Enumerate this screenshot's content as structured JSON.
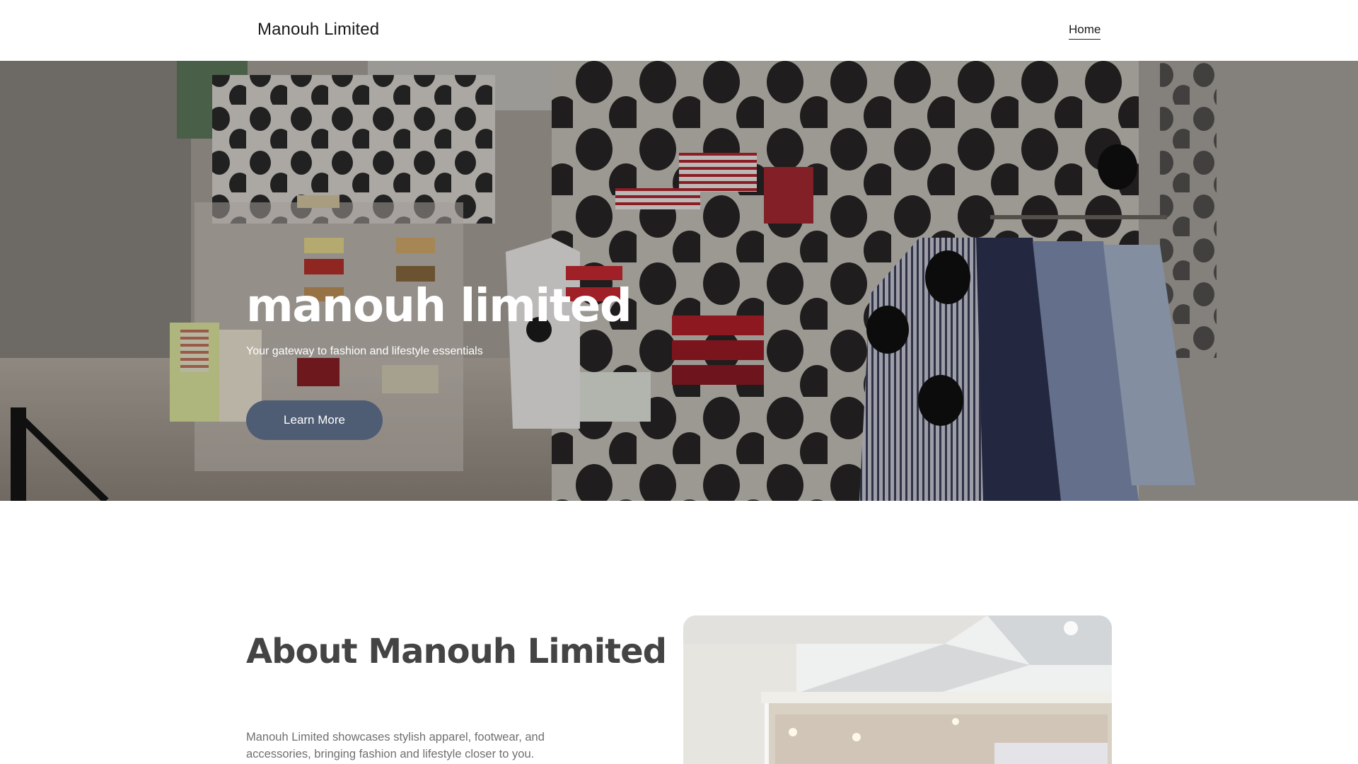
{
  "header": {
    "brand": "Manouh Limited",
    "nav": {
      "home_label": "Home"
    }
  },
  "hero": {
    "title": "manouh limited",
    "subtitle": "Your gateway to fashion and lifestyle essentials",
    "cta_label": "Learn More",
    "cta_color": "#4e5d74"
  },
  "about": {
    "title": "About Manouh Limited",
    "body": "Manouh Limited showcases stylish apparel, footwear, and accessories, bringing fashion and lifestyle closer to you."
  }
}
